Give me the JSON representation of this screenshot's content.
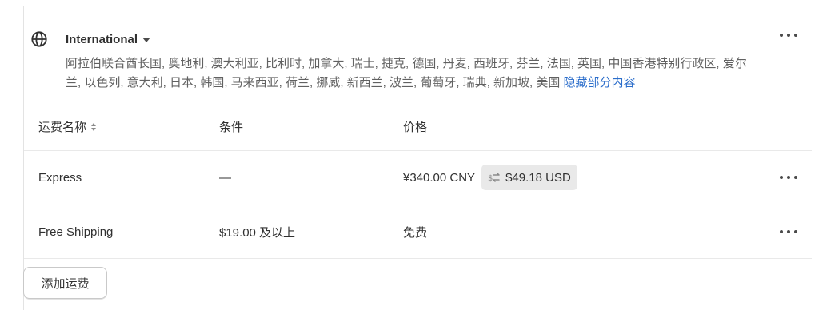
{
  "zone": {
    "icon": "globe-icon",
    "title": "International",
    "countries_text": "阿拉伯联合酋长国, 奥地利, 澳大利亚, 比利时, 加拿大, 瑞士, 捷克, 德国, 丹麦, 西班牙, 芬兰, 法国, 英国, 中国香港特别行政区, 爱尔兰, 以色列, 意大利, 日本, 韩国, 马来西亚, 荷兰, 挪威, 新西兰, 波兰, 葡萄牙, 瑞典, 新加坡, 美国",
    "hide_link": "隐藏部分内容"
  },
  "table": {
    "headers": {
      "name": "运费名称",
      "condition": "条件",
      "price": "价格"
    },
    "rows": [
      {
        "name": "Express",
        "condition": "—",
        "price": "¥340.00 CNY",
        "converted_price": "$49.18 USD"
      },
      {
        "name": "Free Shipping",
        "condition": "$19.00 及以上",
        "price": "免费"
      }
    ]
  },
  "add_button": "添加运费",
  "colors": {
    "link": "#2c6ecb",
    "text": "#303030",
    "muted": "#616161",
    "badge_bg": "#e9e9e9"
  }
}
